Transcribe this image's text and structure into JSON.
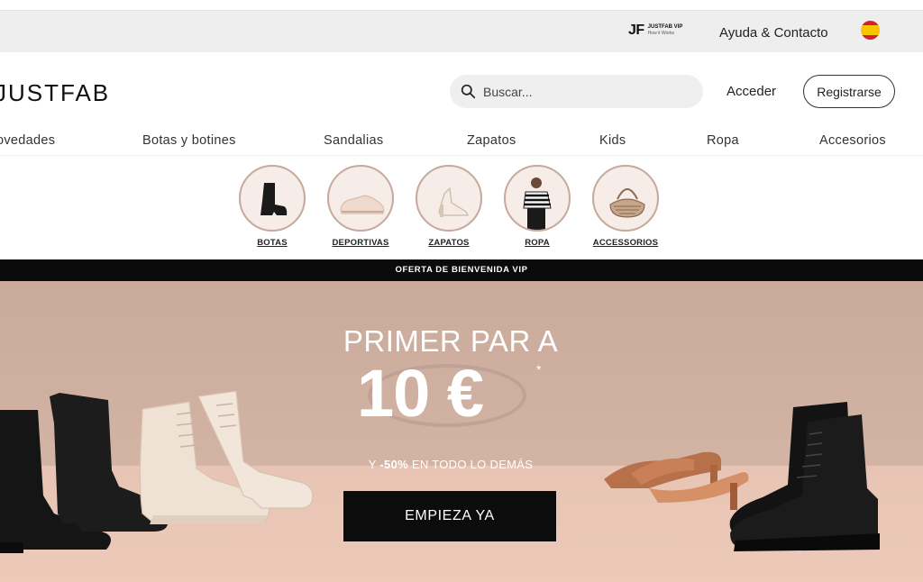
{
  "topbar": {
    "vip_logo_mark": "JF",
    "vip_logo_line1": "JUSTFAB VIP",
    "vip_logo_line2": "How it Works",
    "help_link": "Ayuda & Contacto",
    "flag_icon": "spain-flag-icon"
  },
  "header": {
    "brand": "JUSTFAB",
    "search_placeholder": "Buscar...",
    "login_label": "Acceder",
    "register_label": "Registrarse"
  },
  "nav": {
    "items": [
      "ovedades",
      "Botas y botines",
      "Sandalias",
      "Zapatos",
      "Kids",
      "Ropa",
      "Accesorios"
    ]
  },
  "categories": [
    {
      "label": "BOTAS",
      "icon": "boot-icon"
    },
    {
      "label": "DEPORTIVAS",
      "icon": "sneaker-icon"
    },
    {
      "label": "ZAPATOS",
      "icon": "heel-icon"
    },
    {
      "label": "ROPA",
      "icon": "clothing-icon"
    },
    {
      "label": "ACCESSORIOS",
      "icon": "handbag-icon"
    }
  ],
  "promo_strip": "OFERTA DE BIENVENIDA VIP",
  "hero": {
    "title": "PRIMER PAR A",
    "price": "10 €",
    "asterisk": "*",
    "sub_prefix": "Y",
    "sub_bold": "-50%",
    "sub_suffix": "EN TODO LO DEMÁS",
    "cta": "EMPIEZA YA"
  },
  "colors": {
    "hero_bg": "#d2b3a3",
    "cta_bg": "#0c0c0c",
    "category_ring": "#c6a99c"
  }
}
